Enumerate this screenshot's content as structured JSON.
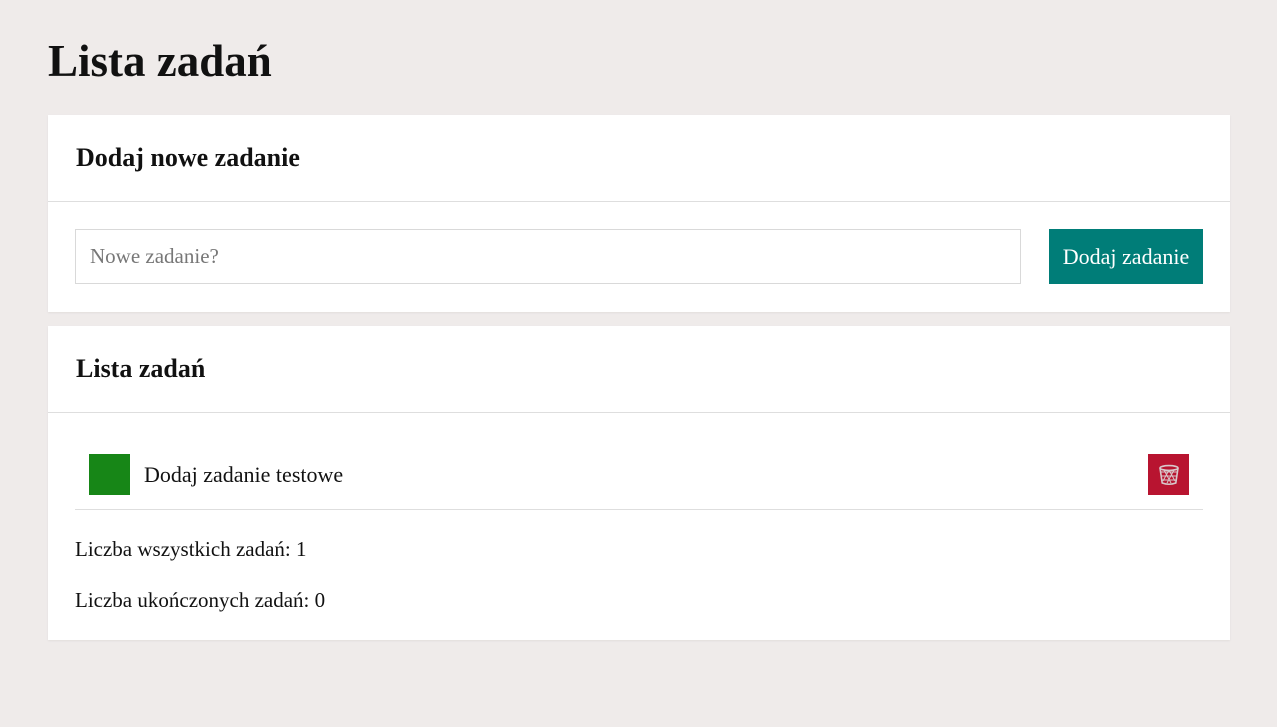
{
  "page": {
    "title": "Lista zadań"
  },
  "add_card": {
    "heading": "Dodaj nowe zadanie",
    "input_value": "",
    "input_placeholder": "Nowe zadanie?",
    "button_label": "Dodaj zadanie"
  },
  "list_card": {
    "heading": "Lista zadań",
    "tasks": [
      {
        "label": "Dodaj zadanie testowe",
        "check_icon": "square-checkbox",
        "delete_icon": "trash-basket-icon"
      }
    ],
    "stats": {
      "total_text": "Liczba wszystkich zadań: 1",
      "done_text": "Liczba ukończonych zadań: 0"
    }
  },
  "colors": {
    "background": "#efebea",
    "card": "#ffffff",
    "accent_button": "#007d78",
    "checkbox": "#178617",
    "delete": "#b81430"
  }
}
